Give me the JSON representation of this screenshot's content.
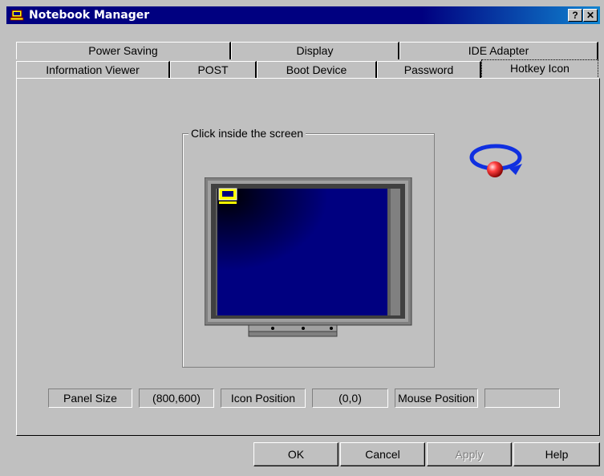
{
  "window": {
    "title": "Notebook Manager",
    "help_btn": "?",
    "close_btn": "✕"
  },
  "tabs_back": [
    {
      "label": "Power Saving"
    },
    {
      "label": "Display"
    },
    {
      "label": "IDE Adapter"
    }
  ],
  "tabs_front": [
    {
      "label": "Information Viewer"
    },
    {
      "label": "POST"
    },
    {
      "label": "Boot Device"
    },
    {
      "label": "Password"
    },
    {
      "label": "Hotkey Icon"
    }
  ],
  "group_label": "Click inside the screen",
  "status": {
    "panel_size_label": "Panel Size",
    "panel_size_value": "(800,600)",
    "icon_position_label": "Icon Position",
    "icon_position_value": "(0,0)",
    "mouse_position_label": "Mouse Position",
    "mouse_position_value": ""
  },
  "buttons": {
    "ok": "OK",
    "cancel": "Cancel",
    "apply": "Apply",
    "help": "Help"
  },
  "icons": {
    "app": "notebook-icon",
    "refresh": "rotate-ball-icon"
  },
  "colors": {
    "titlebar": "#000080",
    "screen": "#000080",
    "face": "#c0c0c0"
  }
}
